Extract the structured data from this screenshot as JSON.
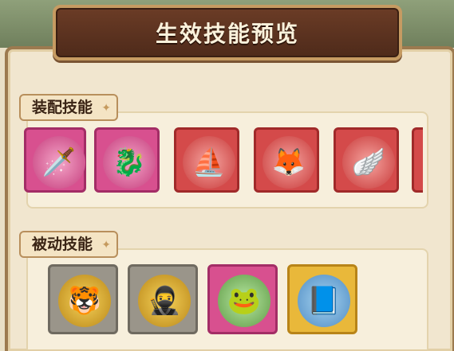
{
  "window": {
    "title": "生效技能预览"
  },
  "sections": {
    "equipped": {
      "label": "装配技能",
      "skills": [
        {
          "icon": "sword-icon",
          "glyph": "🗡️",
          "frame": "pink"
        },
        {
          "icon": "spirit-dragon-icon",
          "glyph": "🐉",
          "frame": "pink"
        },
        {
          "icon": "sailboat-icon",
          "glyph": "⛵",
          "frame": "red"
        },
        {
          "icon": "fox-spirit-icon",
          "glyph": "🦊",
          "frame": "red"
        },
        {
          "icon": "golden-wings-icon",
          "glyph": "🪽",
          "frame": "red"
        }
      ]
    },
    "passive": {
      "label": "被动技能",
      "skills": [
        {
          "icon": "tiger-emblem-icon",
          "glyph": "🐯",
          "frame": "grey"
        },
        {
          "icon": "masked-face-emblem-icon",
          "glyph": "🥷",
          "frame": "grey"
        },
        {
          "icon": "frog-skateboard-icon",
          "glyph": "🐸",
          "frame": "pink"
        },
        {
          "icon": "skull-book-icon",
          "glyph": "📘",
          "frame": "gold"
        }
      ]
    }
  },
  "colors": {
    "pink_frame": "#d8508f",
    "red_frame": "#d44a4a",
    "gold_frame": "#e9b83a",
    "grey_frame": "#9a958a",
    "title_wood": "#5a3220"
  }
}
